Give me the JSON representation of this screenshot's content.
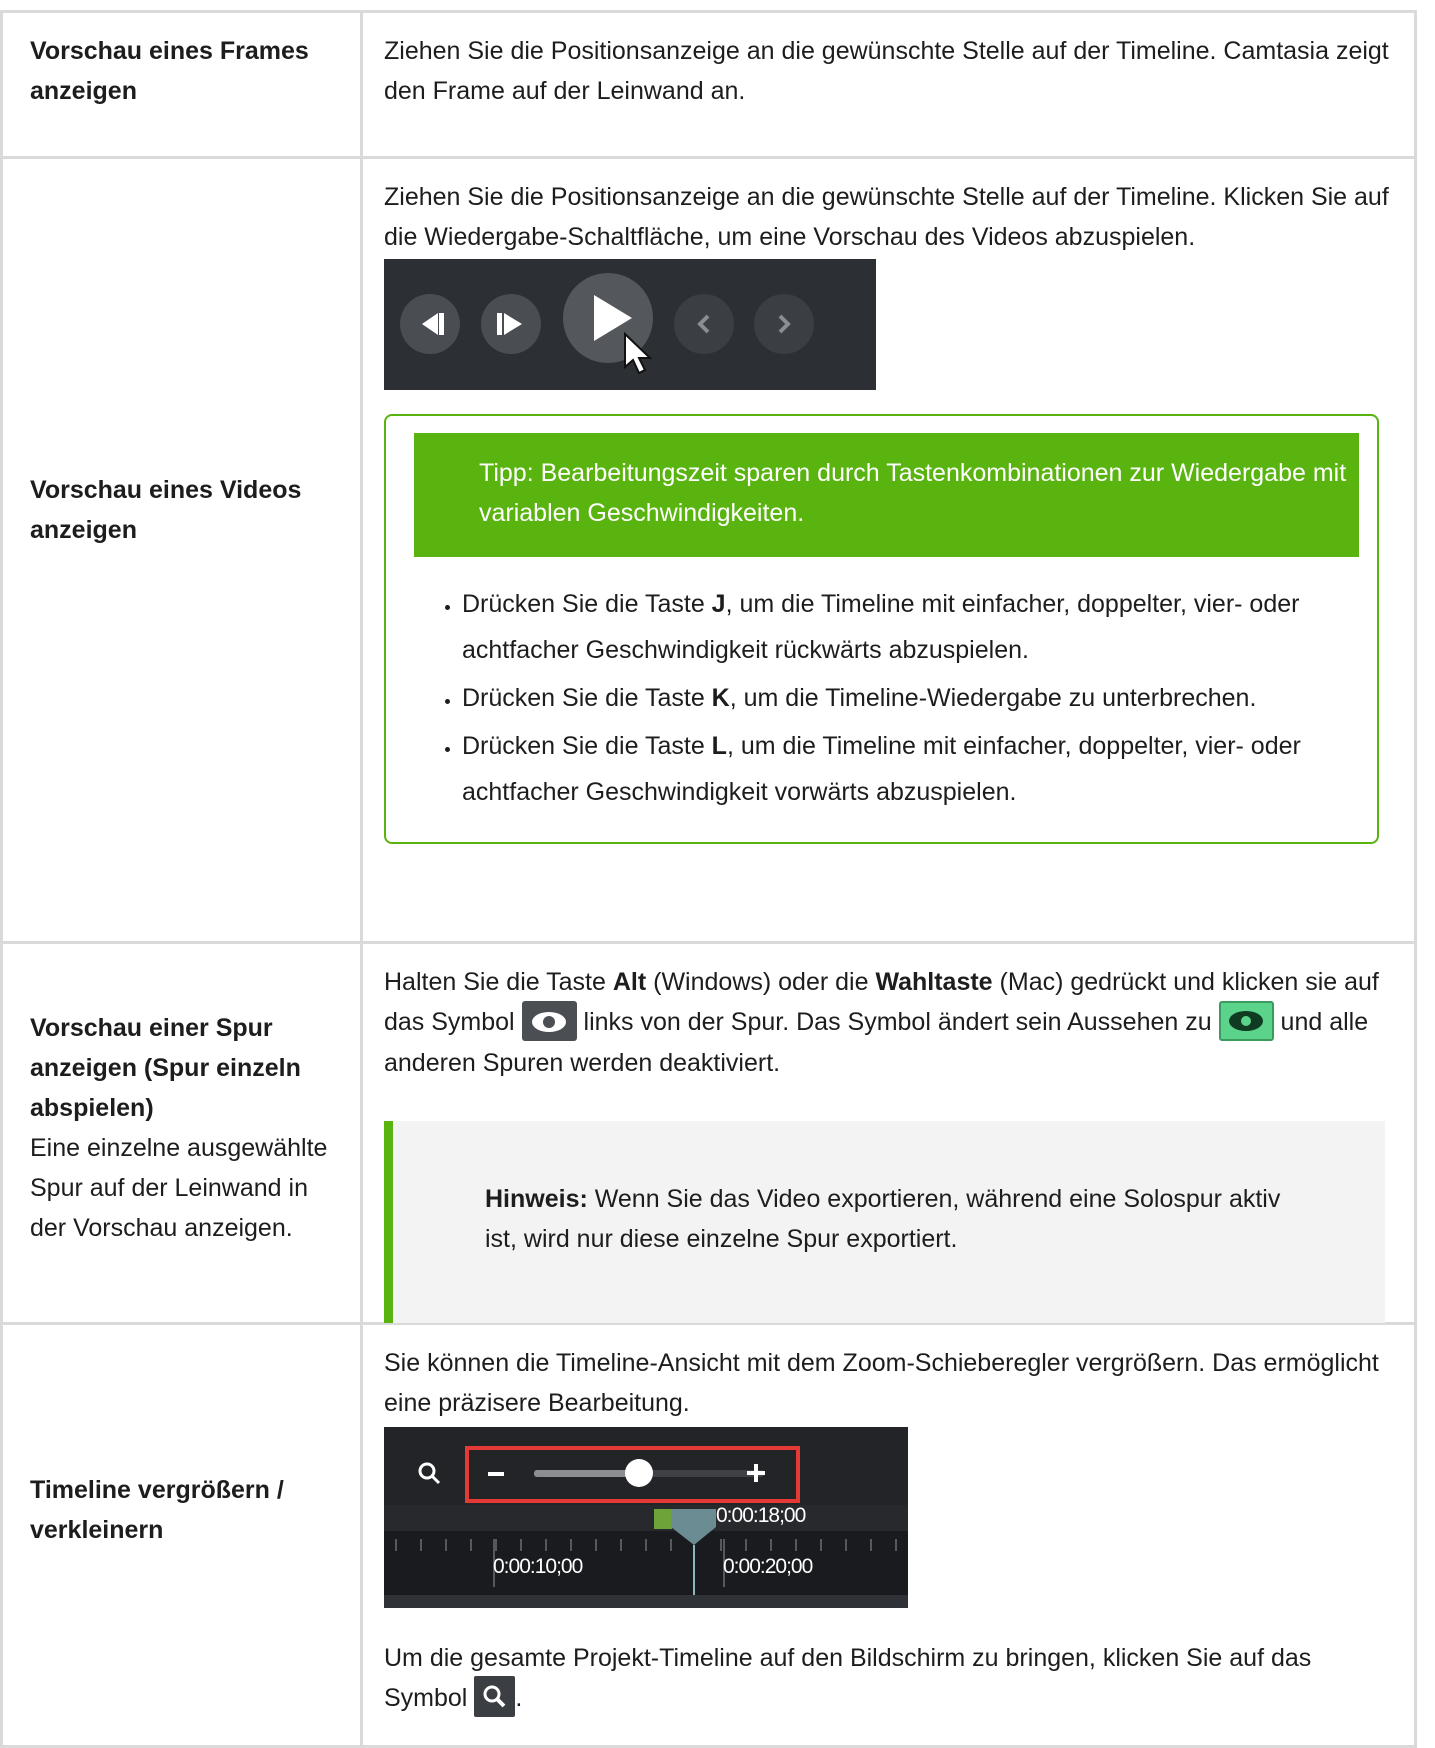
{
  "rows": [
    {
      "label": "Vorschau eines Frames anzeigen",
      "text": "Ziehen Sie die Positionsanzeige an die gewünschte Stelle auf der Timeline. Camtasia zeigt den Frame auf der Leinwand an."
    },
    {
      "label": "Vorschau eines Videos anzeigen",
      "text": "Ziehen Sie die Positionsanzeige an die gewünschte Stelle auf der Timeline. Klicken Sie auf die Wiedergabe-Schaltfläche, um eine Vorschau des Videos abzuspielen.",
      "tip": {
        "header": "Tipp: Bearbeitungszeit sparen durch Tastenkombinationen zur Wiedergabe mit variablen Geschwindigkeiten.",
        "items": [
          {
            "pre": "Drücken Sie die Taste ",
            "key": "J",
            "post": ", um die Timeline mit einfacher, doppelter, vier- oder achtfacher Geschwindigkeit rückwärts abzuspielen."
          },
          {
            "pre": "Drücken Sie die Taste ",
            "key": "K",
            "post": ", um die Timeline-Wiedergabe zu unterbrechen."
          },
          {
            "pre": "Drücken Sie die Taste ",
            "key": "L",
            "post": ", um die Timeline mit einfacher, doppelter, vier- oder achtfacher Geschwindigkeit vorwärts abzuspielen."
          }
        ]
      }
    },
    {
      "label": "Vorschau einer Spur anzeigen (Spur einzeln abspielen)",
      "sublabel": "Eine einzelne ausgewählte Spur auf der Leinwand in der Vorschau anzeigen.",
      "t1": "Halten Sie die Taste ",
      "k1": "Alt",
      "t2": " (Windows) oder die ",
      "k2": "Wahltaste",
      "t3": " (Mac) gedrückt und klicken sie auf das Symbol ",
      "t4": " links von der Spur. Das Symbol ändert sein Aussehen zu ",
      "t5": " und alle anderen Spuren werden deaktiviert.",
      "note_label": "Hinweis:",
      "note_text": " Wenn Sie das Video exportieren, während eine Solospur aktiv ist, wird nur diese einzelne Spur exportiert."
    },
    {
      "label": "Timeline vergrößern / verkleinern",
      "text": "Sie können die Timeline-Ansicht mit dem Zoom-Schieberegler vergrößern. Das ermöglicht eine präzisere Bearbeitung.",
      "zoom_ui": {
        "playhead_time": "0:00:18;00",
        "tick_label_1": "0:00:10;00",
        "tick_label_2": "0:00:20;00",
        "minus": "−",
        "plus": "+"
      },
      "after_1": "Um die gesamte Projekt-Timeline auf den Bildschirm zu bringen, klicken Sie auf das Symbol ",
      "after_2": "."
    }
  ],
  "colors": {
    "accent_green": "#5ab40f",
    "border": "#dadada",
    "note_bg": "#f3f3f3"
  },
  "icons": [
    "step-back-icon",
    "step-forward-icon",
    "play-icon",
    "cursor-icon",
    "chevron-left-icon",
    "chevron-right-icon",
    "eye-icon",
    "solo-eye-icon",
    "magnifier-icon"
  ]
}
